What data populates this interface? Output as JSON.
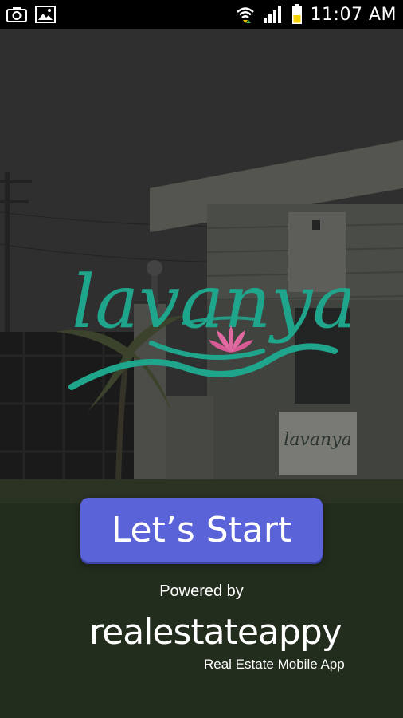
{
  "status_bar": {
    "time": "11:07 AM",
    "icons": [
      "camera-icon",
      "image-icon",
      "wifi-icon",
      "signal-icon",
      "battery-icon"
    ]
  },
  "splash": {
    "logo_text": "lavanya",
    "sign_text": "lavanya",
    "start_button_label": "Let’s Start",
    "powered_by": "Powered by",
    "brand_name": "realestateappy",
    "brand_tagline": "Real Estate Mobile App"
  },
  "colors": {
    "logo_teal": "#1fa58c",
    "lotus_pink": "#e06aa0",
    "button_blue": "#5b63d8",
    "phone_icon_blue": "#5560d6"
  }
}
